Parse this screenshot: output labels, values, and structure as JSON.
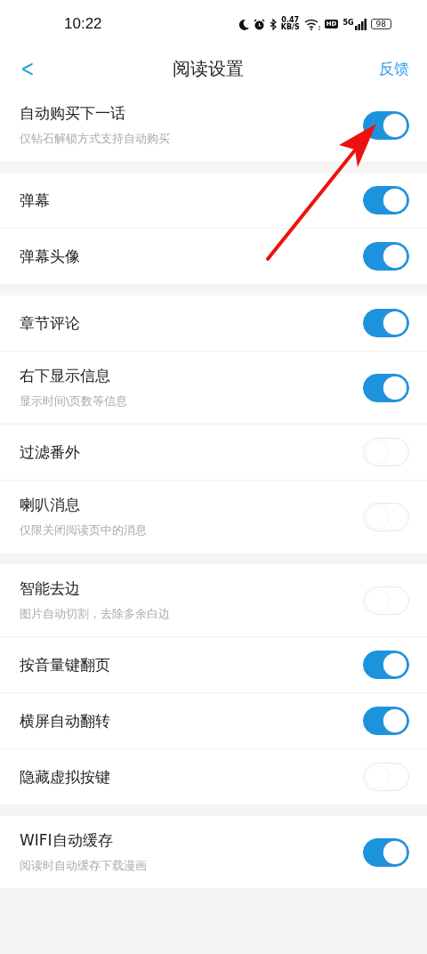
{
  "status_bar": {
    "time": "10:22",
    "speed": "0.47",
    "speed_unit": "KB/S",
    "hd": "HD",
    "network": "5G",
    "battery": "98"
  },
  "nav": {
    "back": "<",
    "title": "阅读设置",
    "action": "反馈"
  },
  "groups": [
    {
      "items": [
        {
          "label": "自动购买下一话",
          "hint": "仅钻石解锁方式支持自动购买",
          "on": true
        }
      ]
    },
    {
      "items": [
        {
          "label": "弹幕",
          "on": true
        },
        {
          "label": "弹幕头像",
          "on": true
        }
      ]
    },
    {
      "items": [
        {
          "label": "章节评论",
          "on": true
        },
        {
          "label": "右下显示信息",
          "hint": "显示时间\\页数等信息",
          "on": true
        },
        {
          "label": "过滤番外",
          "on": false
        },
        {
          "label": "喇叭消息",
          "hint": "仅限关闭阅读页中的消息",
          "on": false
        }
      ]
    },
    {
      "items": [
        {
          "label": "智能去边",
          "hint": "图片自动切割，去除多余白边",
          "on": false
        },
        {
          "label": "按音量键翻页",
          "on": true
        },
        {
          "label": "横屏自动翻转",
          "on": true
        },
        {
          "label": "隐藏虚拟按键",
          "on": false
        }
      ]
    },
    {
      "items": [
        {
          "label": "WIFI自动缓存",
          "hint": "阅读时自动缓存下载漫画",
          "on": true
        }
      ]
    }
  ],
  "annotation": {
    "kind": "arrow"
  }
}
